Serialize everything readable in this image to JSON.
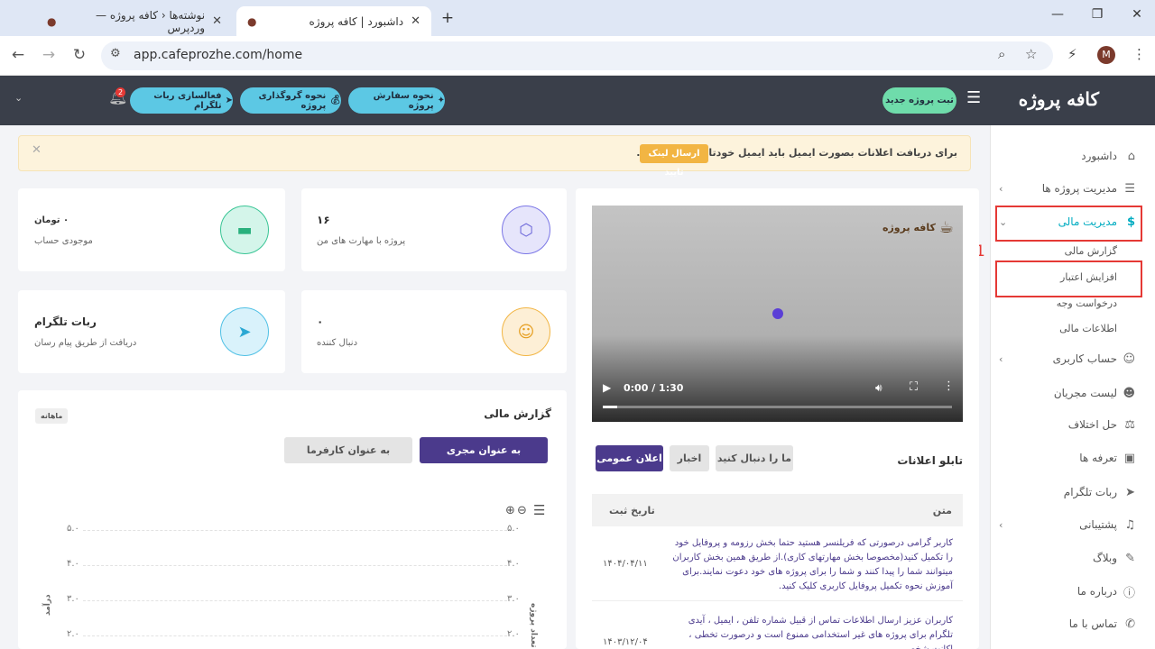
{
  "browser": {
    "tabs": [
      {
        "title": "نوشته‌ها ‹ کافه پروژه — وردپرس"
      },
      {
        "title": "داشبورد | کافه پروژه"
      }
    ],
    "new_tab": "+",
    "url": "app.cafeprozhe.com/home",
    "profile_initial": "M"
  },
  "header": {
    "logo": "کافه پروژه",
    "new_project_label": "ثبت پروژه جدید",
    "buttons": [
      {
        "label": "نحوه سفارش پروژه"
      },
      {
        "label": "نحوه گروگذاری پروژه"
      },
      {
        "label": "فعالسازی ربات تلگرام"
      }
    ],
    "notification_count": "2"
  },
  "sidebar": {
    "items": [
      {
        "label": "داشبورد",
        "icon": "home-icon"
      },
      {
        "label": "مدیریت پروژه ها",
        "icon": "list-icon"
      },
      {
        "label": "مدیریت مالی",
        "icon": "dollar-icon"
      },
      {
        "label": "حساب کاربری",
        "icon": "user-icon"
      },
      {
        "label": "لیست مجریان",
        "icon": "users-icon"
      },
      {
        "label": "حل اختلاف",
        "icon": "scale-icon"
      },
      {
        "label": "تعرفه ها",
        "icon": "bag-icon"
      },
      {
        "label": "ربات تلگرام",
        "icon": "send-icon"
      },
      {
        "label": "پشتیبانی",
        "icon": "headset-icon"
      },
      {
        "label": "وبلاگ",
        "icon": "blog-icon"
      },
      {
        "label": "درباره ما",
        "icon": "info-icon"
      },
      {
        "label": "تماس با ما",
        "icon": "phone-icon"
      }
    ],
    "finance_sub": [
      "گزارش مالی",
      "افزایش اعتبار",
      "درخواست وجه",
      "اطلاعات مالی"
    ],
    "annotation": "1"
  },
  "alert": {
    "text": "برای دریافت اعلانات بصورت ایمیل باید ایمیل خودتان را تایید کنید.",
    "button": "ارسال لینک تایید"
  },
  "stats": {
    "projects": {
      "value": "۱۶",
      "label": "پروژه با مهارت های من"
    },
    "balance": {
      "value": "۰ تومان",
      "label": "موجودی حساب"
    },
    "followers": {
      "value": "۰",
      "label": "دنبال کننده"
    },
    "telegram": {
      "value": "ربات تلگرام",
      "label": "دریافت از طریق پیام رسان"
    }
  },
  "video": {
    "time": "0:00 / 1:30",
    "watermark": "کافه پروژه"
  },
  "announcements": {
    "title": "تابلو اعلانات",
    "tabs": [
      "اعلان عمومی",
      "اخبار",
      "ما را دنبال کنید"
    ],
    "columns": [
      "متن",
      "تاریخ ثبت"
    ],
    "rows": [
      {
        "text": "کاربر گرامی درصورتی که فریلنسر هستید حتما بخش رزومه و پروفایل خود را تکمیل کنید(مخصوصا بخش مهارتهای کاری).از طریق همین بخش کاربران میتوانند شما را پیدا کنند و شما را برای پروژه های خود دعوت نمایند.برای آموزش نحوه تکمیل پروفایل کاربری کلیک کنید.",
        "date": "۱۴۰۴/۰۴/۱۱"
      },
      {
        "text": "کاربران عزیز ارسال اطلاعات تماس از قبیل شماره تلفن ، ایمیل ، آیدی تلگرام برای پروژه های غیر استخدامی ممنوع است و درصورت تخطی ، اکانت شخص",
        "date": "۱۴۰۳/۱۲/۰۴"
      }
    ]
  },
  "finance_report": {
    "title": "گزارش مالی",
    "period": "ماهانه",
    "tab_active": "به عنوان مجری",
    "tab_inactive": "به عنوان کارفرما",
    "y_left_label": "تعداد پروژه",
    "y_right_label": "درآمد"
  },
  "chart_data": {
    "type": "line",
    "yticks": [
      "۵.۰",
      "۴.۰",
      "۳.۰",
      "۲.۰"
    ],
    "ylabel_left": "تعداد پروژه",
    "ylabel_right": "درآمد",
    "series": []
  },
  "colors": {
    "accent_purple": "#4b3a8c",
    "finance_active": "#00bcd4",
    "header_bg": "#3a3f4a",
    "annotation_red": "#e53935"
  }
}
